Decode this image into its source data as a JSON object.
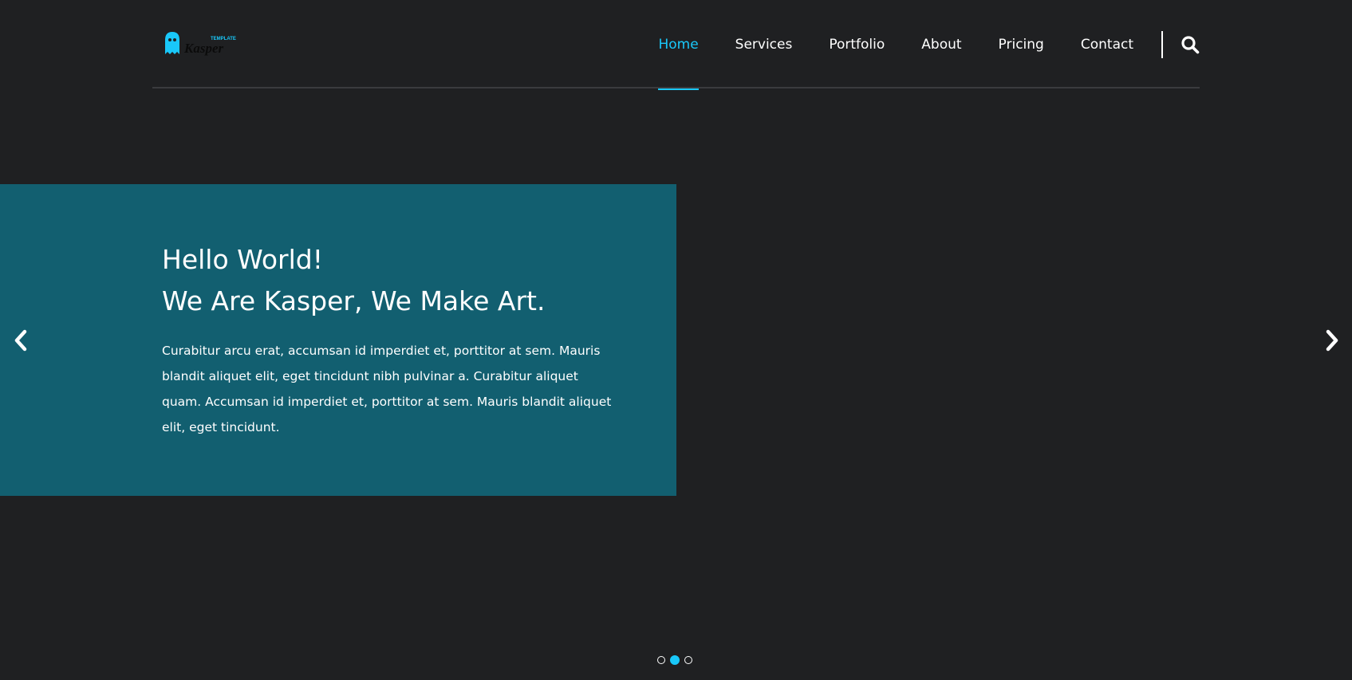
{
  "logo": {
    "small_text": "TEMPLATE",
    "main_text": "Kasper",
    "accent_color": "#19c8fa"
  },
  "nav": {
    "items": [
      {
        "label": "Home",
        "active": true
      },
      {
        "label": "Services",
        "active": false
      },
      {
        "label": "Portfolio",
        "active": false
      },
      {
        "label": "About",
        "active": false
      },
      {
        "label": "Pricing",
        "active": false
      },
      {
        "label": "Contact",
        "active": false
      }
    ],
    "search_icon": "search-icon"
  },
  "hero": {
    "title_line1": "Hello World!",
    "title_line2": "We Are Kasper, We Make Art.",
    "text": "Curabitur arcu erat, accumsan id imperdiet et, porttitor at sem. Mauris blandit aliquet elit, eget tincidunt nibh pulvinar a. Curabitur aliquet quam. Accumsan id imperdiet et, porttitor at sem. Mauris blandit aliquet elit, eget tincidunt.",
    "box_color": "#125f70",
    "prev_icon": "chevron-left-icon",
    "next_icon": "chevron-right-icon"
  },
  "carousel": {
    "slide_count": 3,
    "active_index": 1
  },
  "colors": {
    "background": "#1f2022",
    "accent": "#19c8fa"
  }
}
